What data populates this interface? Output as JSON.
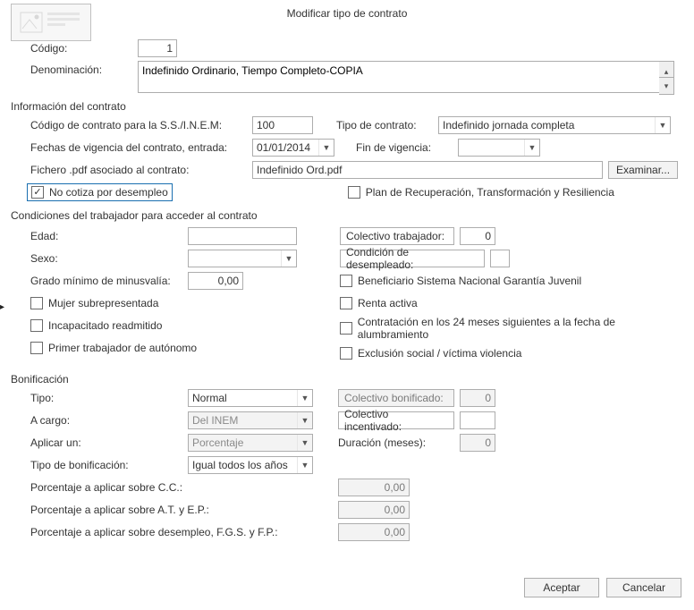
{
  "title": "Modificar tipo de contrato",
  "header": {
    "codigo_label": "Código:",
    "codigo_value": "1",
    "denominacion_label": "Denominación:",
    "denominacion_value": "Indefinido Ordinario, Tiempo Completo-COPIA"
  },
  "info": {
    "section": "Información del contrato",
    "codigo_ss_label": "Código de contrato para la S.S./I.N.E.M:",
    "codigo_ss_value": "100",
    "tipo_contrato_label": "Tipo de contrato:",
    "tipo_contrato_value": "Indefinido jornada completa",
    "fechas_label": "Fechas de vigencia del contrato, entrada:",
    "fecha_entrada_value": "01/01/2014",
    "fin_vigencia_label": "Fin de vigencia:",
    "fin_vigencia_value": "",
    "fichero_label": "Fichero .pdf asociado al contrato:",
    "fichero_value": "Indefinido Ord.pdf",
    "examinar": "Examinar...",
    "no_cotiza": "No cotiza por desempleo",
    "plan": "Plan de Recuperación, Transformación y Resiliencia"
  },
  "cond": {
    "section": "Condiciones del trabajador para acceder al contrato",
    "edad_label": "Edad:",
    "edad_value": "",
    "colectivo_trab_label": "Colectivo trabajador:",
    "colectivo_trab_value": "0",
    "sexo_label": "Sexo:",
    "sexo_value": "",
    "cond_desemp_label": "Condición de desempleado:",
    "cond_desemp_value": "",
    "grado_label": "Grado mínimo de minusvalía:",
    "grado_value": "0,00",
    "mujer": "Mujer subrepresentada",
    "incapacitado": "Incapacitado readmitido",
    "primer": "Primer trabajador de autónomo",
    "beneficiario": "Beneficiario Sistema Nacional Garantía Juvenil",
    "renta": "Renta activa",
    "contratacion24": "Contratación en los 24 meses siguientes a la fecha de alumbramiento",
    "exclusion": "Exclusión social  / víctima violencia"
  },
  "bon": {
    "section": "Bonificación",
    "tipo_label": "Tipo:",
    "tipo_value": "Normal",
    "col_bonif_label": "Colectivo bonificado:",
    "col_bonif_value": "0",
    "acargo_label": "A cargo:",
    "acargo_value": "Del INEM",
    "col_incent_label": "Colectivo incentivado:",
    "col_incent_value": "",
    "aplicar_label": "Aplicar un:",
    "aplicar_value": "Porcentaje",
    "duracion_label": "Duración (meses):",
    "duracion_value": "0",
    "tipo_bonif_label": "Tipo de bonificación:",
    "tipo_bonif_value": "Igual todos los años",
    "pct_cc_label": "Porcentaje a aplicar sobre C.C.:",
    "pct_cc_value": "0,00",
    "pct_at_label": "Porcentaje a aplicar sobre A.T. y E.P.:",
    "pct_at_value": "0,00",
    "pct_des_label": "Porcentaje a aplicar sobre desempleo, F.G.S. y F.P.:",
    "pct_des_value": "0,00"
  },
  "buttons": {
    "aceptar": "Aceptar",
    "cancelar": "Cancelar"
  }
}
